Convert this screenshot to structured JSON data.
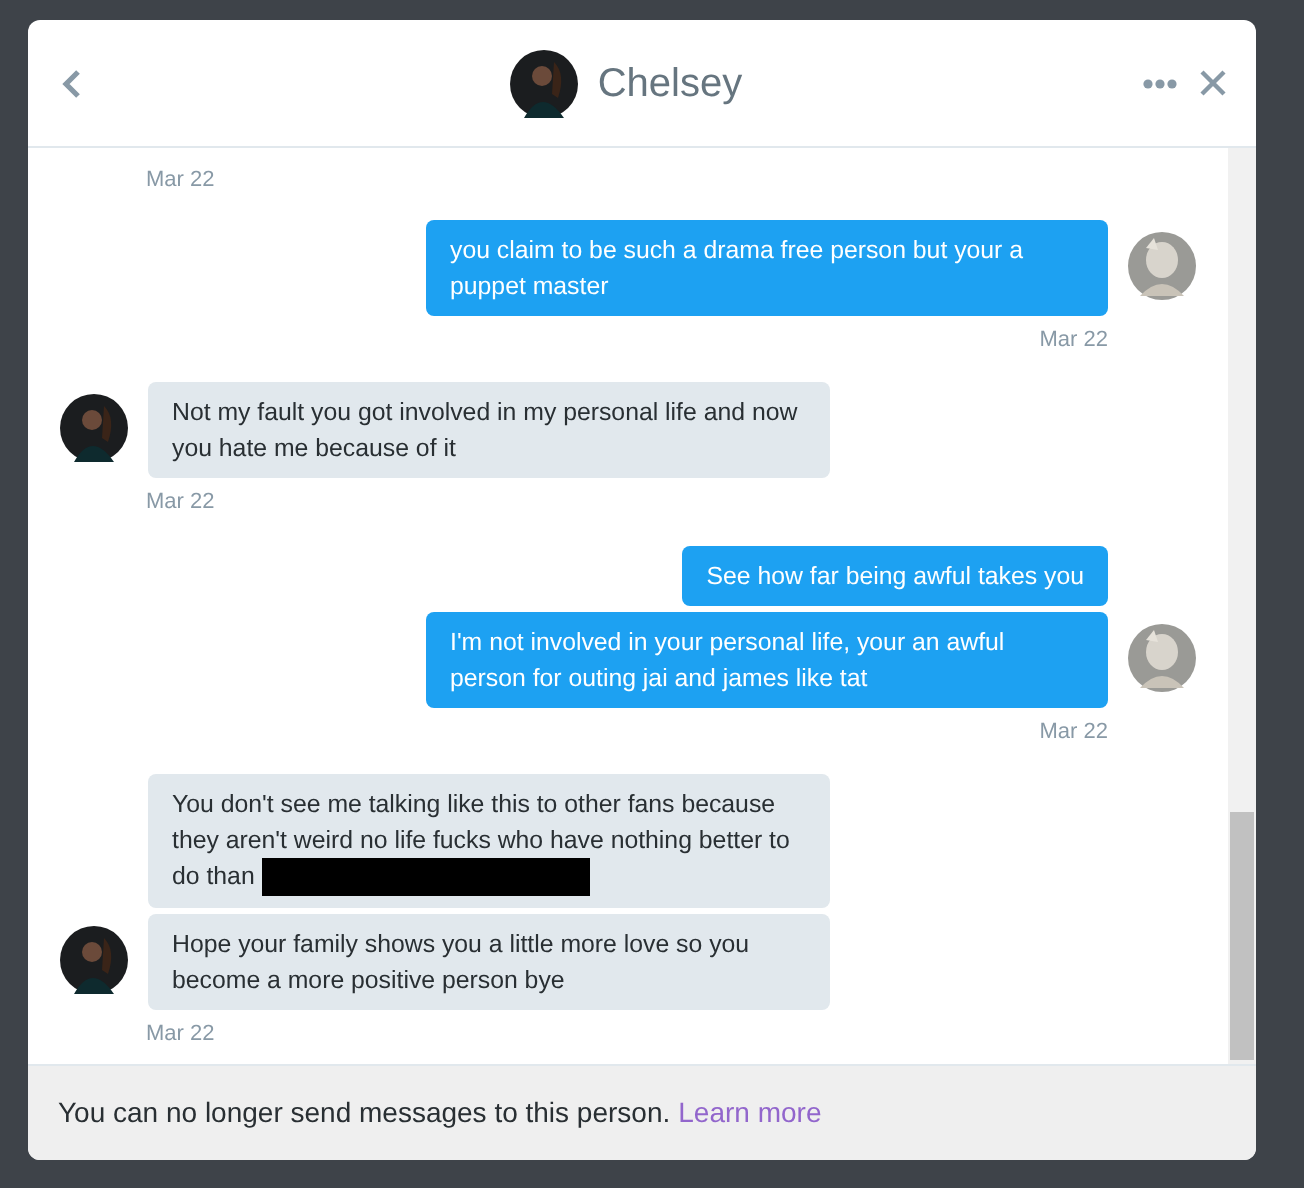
{
  "header": {
    "title": "Chelsey"
  },
  "conversation": [
    {
      "kind": "date_only",
      "date": "Mar 22"
    },
    {
      "kind": "sent",
      "date": "Mar 22",
      "messages": [
        {
          "text": "you claim to be such a drama free person but your a puppet master",
          "redacted": false
        }
      ]
    },
    {
      "kind": "received",
      "date": "Mar 22",
      "messages": [
        {
          "text": "Not my fault you got involved in my personal life and now you hate me because of it",
          "redacted": false
        }
      ]
    },
    {
      "kind": "sent",
      "date": "Mar 22",
      "messages": [
        {
          "text": "See how far being awful takes you",
          "redacted": false
        },
        {
          "text": "I'm not involved in your personal life, your an awful person for outing jai and james like tat",
          "redacted": false
        }
      ]
    },
    {
      "kind": "received",
      "date": "Mar 22",
      "messages": [
        {
          "text": "You don't see me talking like this to other fans because they aren't weird no life fucks who have nothing better to do than",
          "redacted": true
        },
        {
          "text": "Hope your family shows you a little more love so you become a more positive person bye",
          "redacted": false
        }
      ]
    }
  ],
  "footer": {
    "notice": "You can no longer send messages to this person.",
    "link": "Learn more"
  }
}
